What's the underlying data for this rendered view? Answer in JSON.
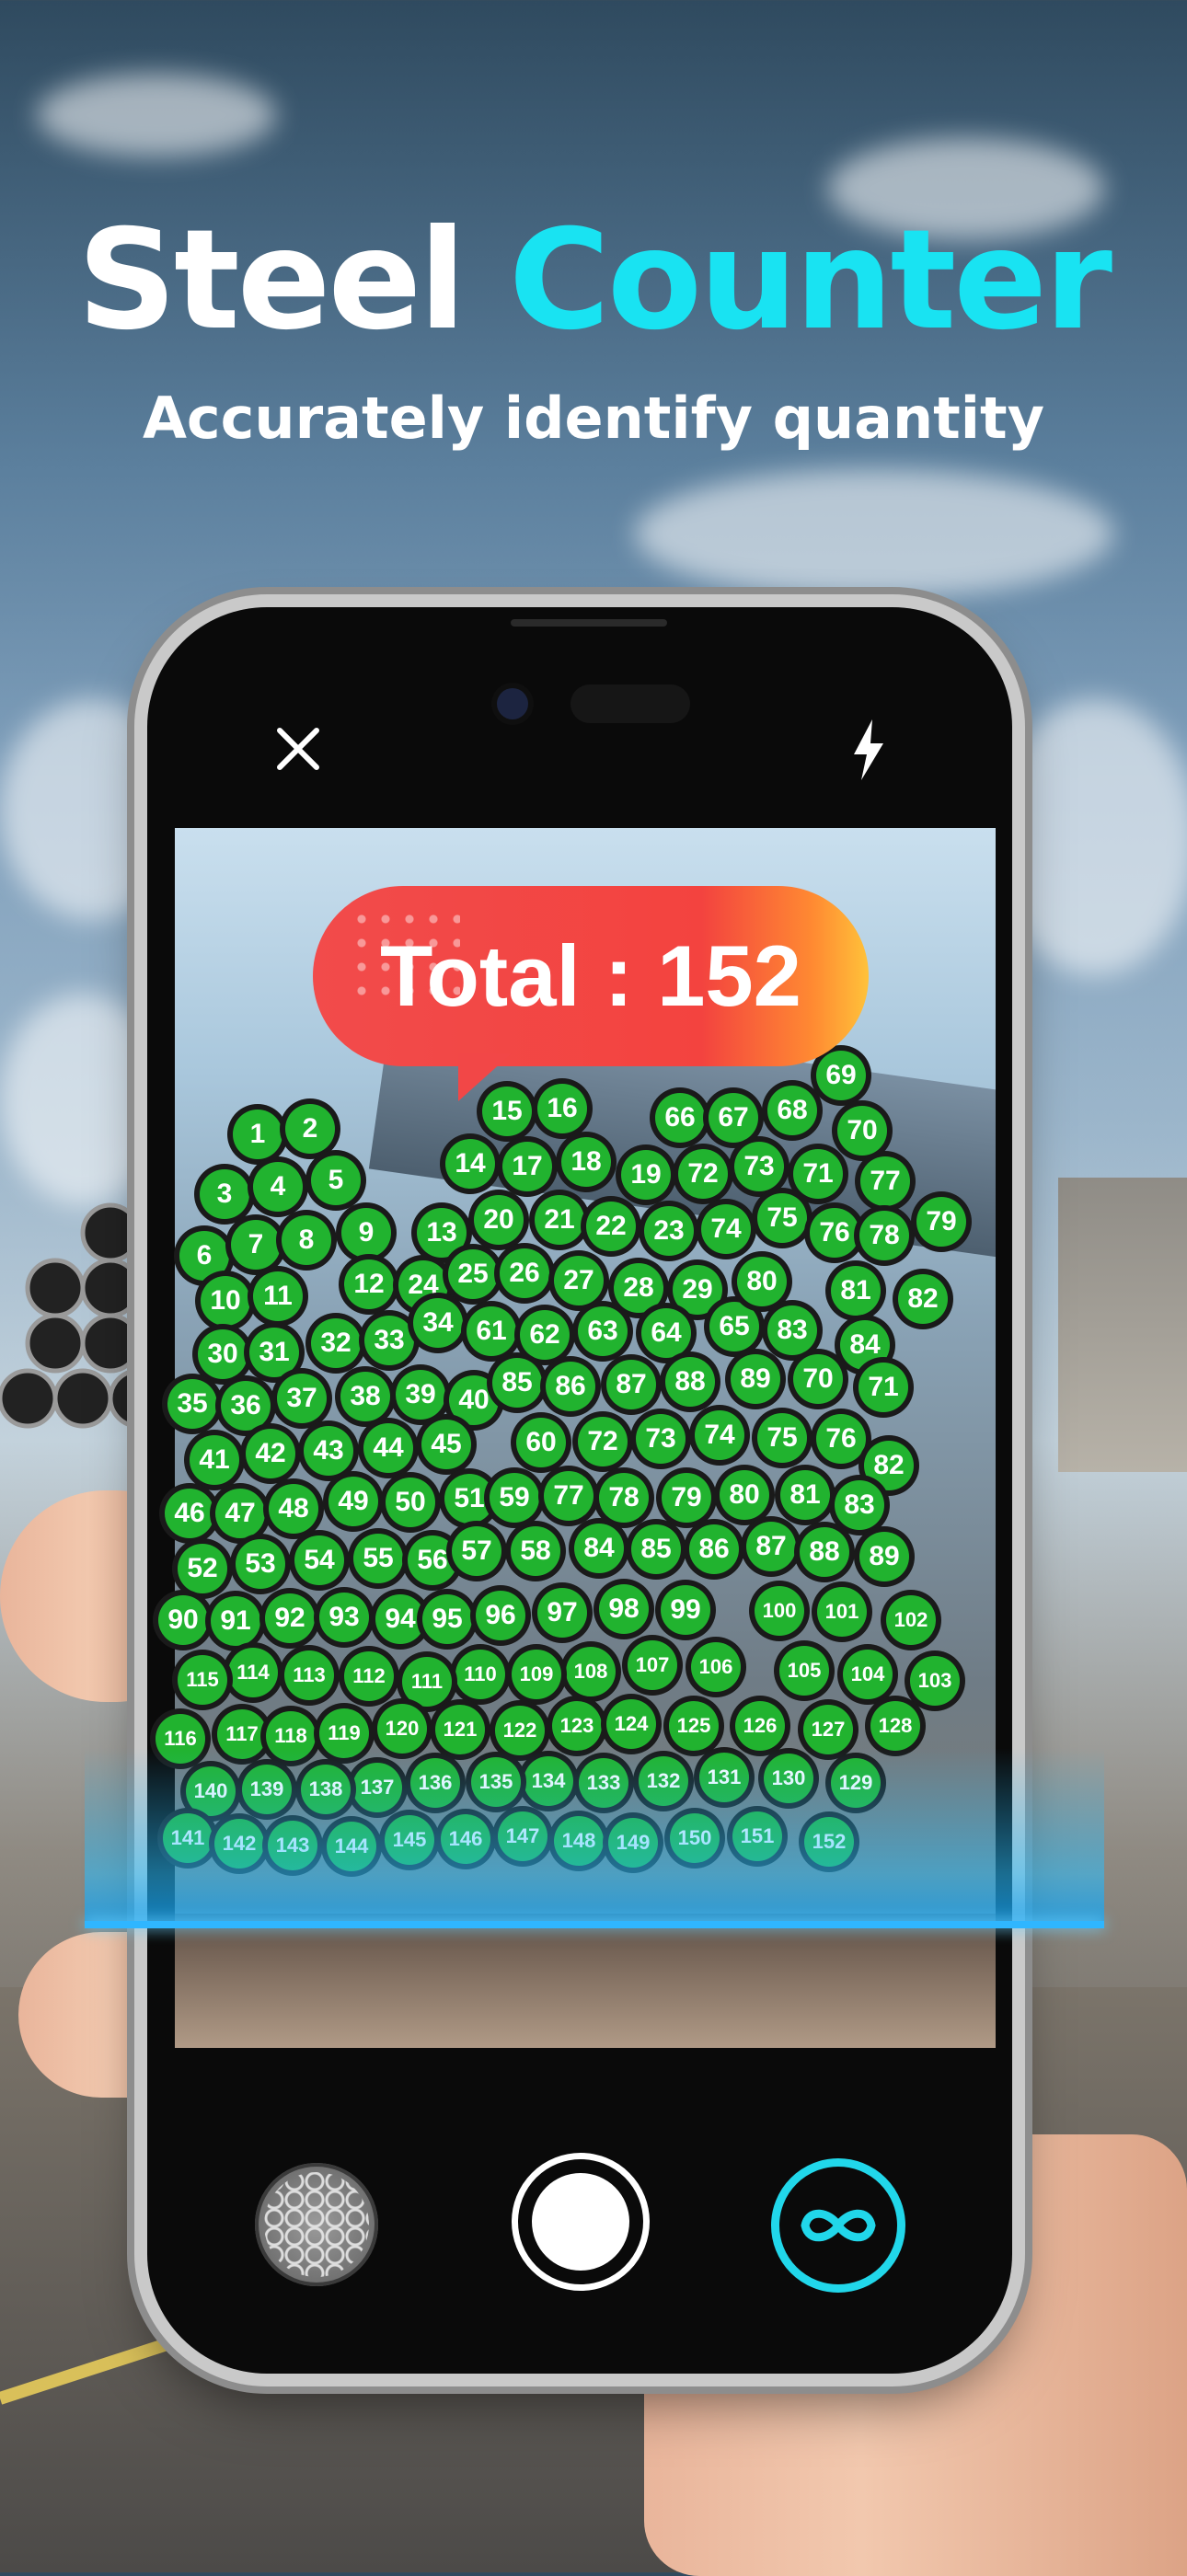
{
  "headline": {
    "word1": "Steel",
    "word2": "Counter",
    "subtitle": "Accurately identify quantity"
  },
  "camera": {
    "close_icon": "close-icon",
    "flash_icon": "flash-icon",
    "total_label": "Total : 152"
  },
  "controls": {
    "grid_mode_icon": "circle-grid-icon",
    "shutter_icon": "shutter-icon",
    "loop_icon": "infinity-icon"
  },
  "markers": [
    "1",
    "2",
    "3",
    "4",
    "5",
    "6",
    "7",
    "8",
    "9",
    "10",
    "11",
    "12",
    "13",
    "14",
    "15",
    "16",
    "17",
    "18",
    "19",
    "20",
    "21",
    "22",
    "23",
    "24",
    "25",
    "26",
    "27",
    "28",
    "29",
    "30",
    "31",
    "32",
    "33",
    "34",
    "35",
    "36",
    "37",
    "38",
    "39",
    "40",
    "41",
    "42",
    "43",
    "44",
    "45",
    "46",
    "47",
    "48",
    "49",
    "50",
    "51",
    "52",
    "53",
    "54",
    "55",
    "56",
    "57",
    "58",
    "59",
    "60",
    "61",
    "62",
    "63",
    "64",
    "65",
    "66",
    "67",
    "68",
    "69",
    "70",
    "71",
    "72",
    "73",
    "74",
    "75",
    "76",
    "77",
    "78",
    "79",
    "80",
    "81",
    "82",
    "83",
    "84",
    "85",
    "86",
    "87",
    "88",
    "89",
    "90",
    "91",
    "92",
    "93",
    "94",
    "95",
    "96",
    "97",
    "98",
    "99",
    "100",
    "101",
    "102",
    "103",
    "104",
    "105",
    "106",
    "107",
    "108",
    "109",
    "110",
    "111",
    "112",
    "113",
    "114",
    "115",
    "116",
    "117",
    "118",
    "119",
    "120",
    "121",
    "122",
    "123",
    "124",
    "125",
    "126",
    "127",
    "128",
    "129",
    "130",
    "131",
    "132",
    "133",
    "134",
    "135",
    "136",
    "137",
    "138",
    "139",
    "140",
    "141",
    "142",
    "143",
    "144",
    "145",
    "146",
    "147",
    "148",
    "149",
    "150",
    "151",
    "152"
  ],
  "colors": {
    "accent": "#19e3f2",
    "marker": "#21b32f",
    "bubble_start": "#f24b4b",
    "bubble_end": "#ffc23a",
    "scan": "#2fb6ff"
  }
}
